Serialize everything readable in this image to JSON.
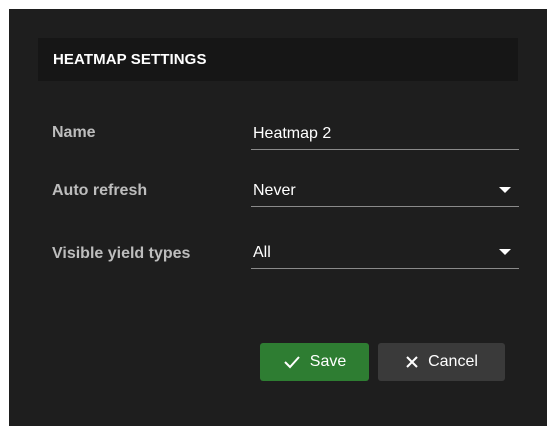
{
  "dialog": {
    "title": "HEATMAP SETTINGS",
    "fields": {
      "name": {
        "label": "Name",
        "value": "Heatmap 2"
      },
      "auto_refresh": {
        "label": "Auto refresh",
        "value": "Never"
      },
      "visible_yield_types": {
        "label": "Visible yield types",
        "value": "All"
      }
    },
    "buttons": {
      "save_label": "Save",
      "cancel_label": "Cancel"
    }
  },
  "colors": {
    "dialog_bg": "#1e1e1e",
    "header_bg": "#161616",
    "save_bg": "#2e7d32",
    "cancel_bg": "#3a3a3a"
  },
  "icons": {
    "save": "check-icon",
    "cancel": "close-icon",
    "dropdown": "caret-down-icon"
  }
}
